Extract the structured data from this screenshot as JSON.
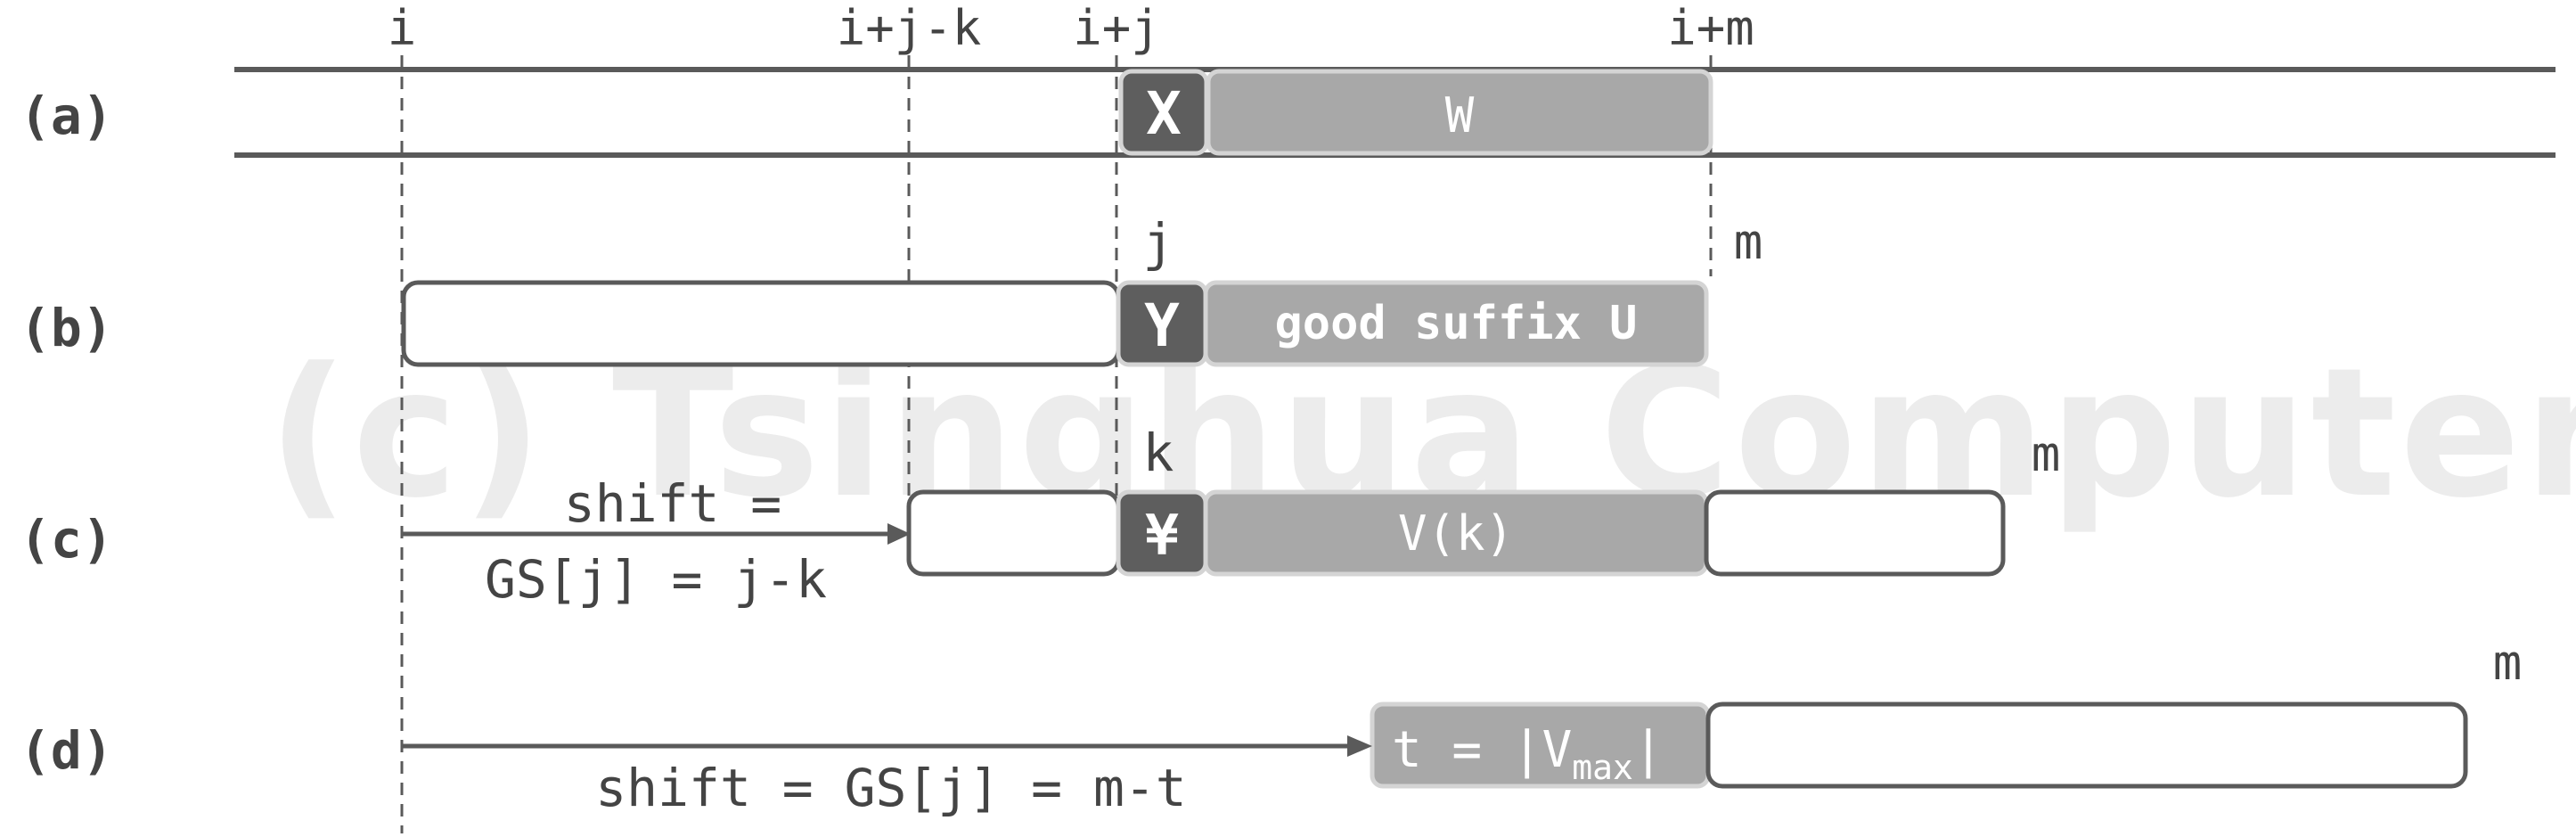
{
  "rows": {
    "a": "(a)",
    "b": "(b)",
    "c": "(c)",
    "d": "(d)"
  },
  "top_labels": {
    "i": "i",
    "i_j_k": "i+j-k",
    "i_j": "i+j",
    "i_m": "i+m"
  },
  "row_a": {
    "x_char": "X",
    "w_label": "W"
  },
  "row_b": {
    "j_label": "j",
    "m_label": "m",
    "y_char": "Y",
    "suffix_label": "good suffix U"
  },
  "row_c": {
    "k_label": "k",
    "m_label": "m",
    "y_char": "¥",
    "v_label": "V(k)",
    "shift_line1": "shift =",
    "shift_line2": "GS[j] = j-k"
  },
  "row_d": {
    "m_label": "m",
    "t_prefix": "t = |V",
    "t_sub": "max",
    "t_suffix": "|",
    "shift_label": "shift = GS[j] = m-t"
  },
  "watermark": "(c) Tsinghua Computer",
  "colors": {
    "line": "#5a5a5a",
    "dark_box": "#5e5e5e",
    "light_box": "#a8a8a8",
    "box_border": "#d4d4d4",
    "text": "#444444",
    "watermark": "#ececec"
  }
}
